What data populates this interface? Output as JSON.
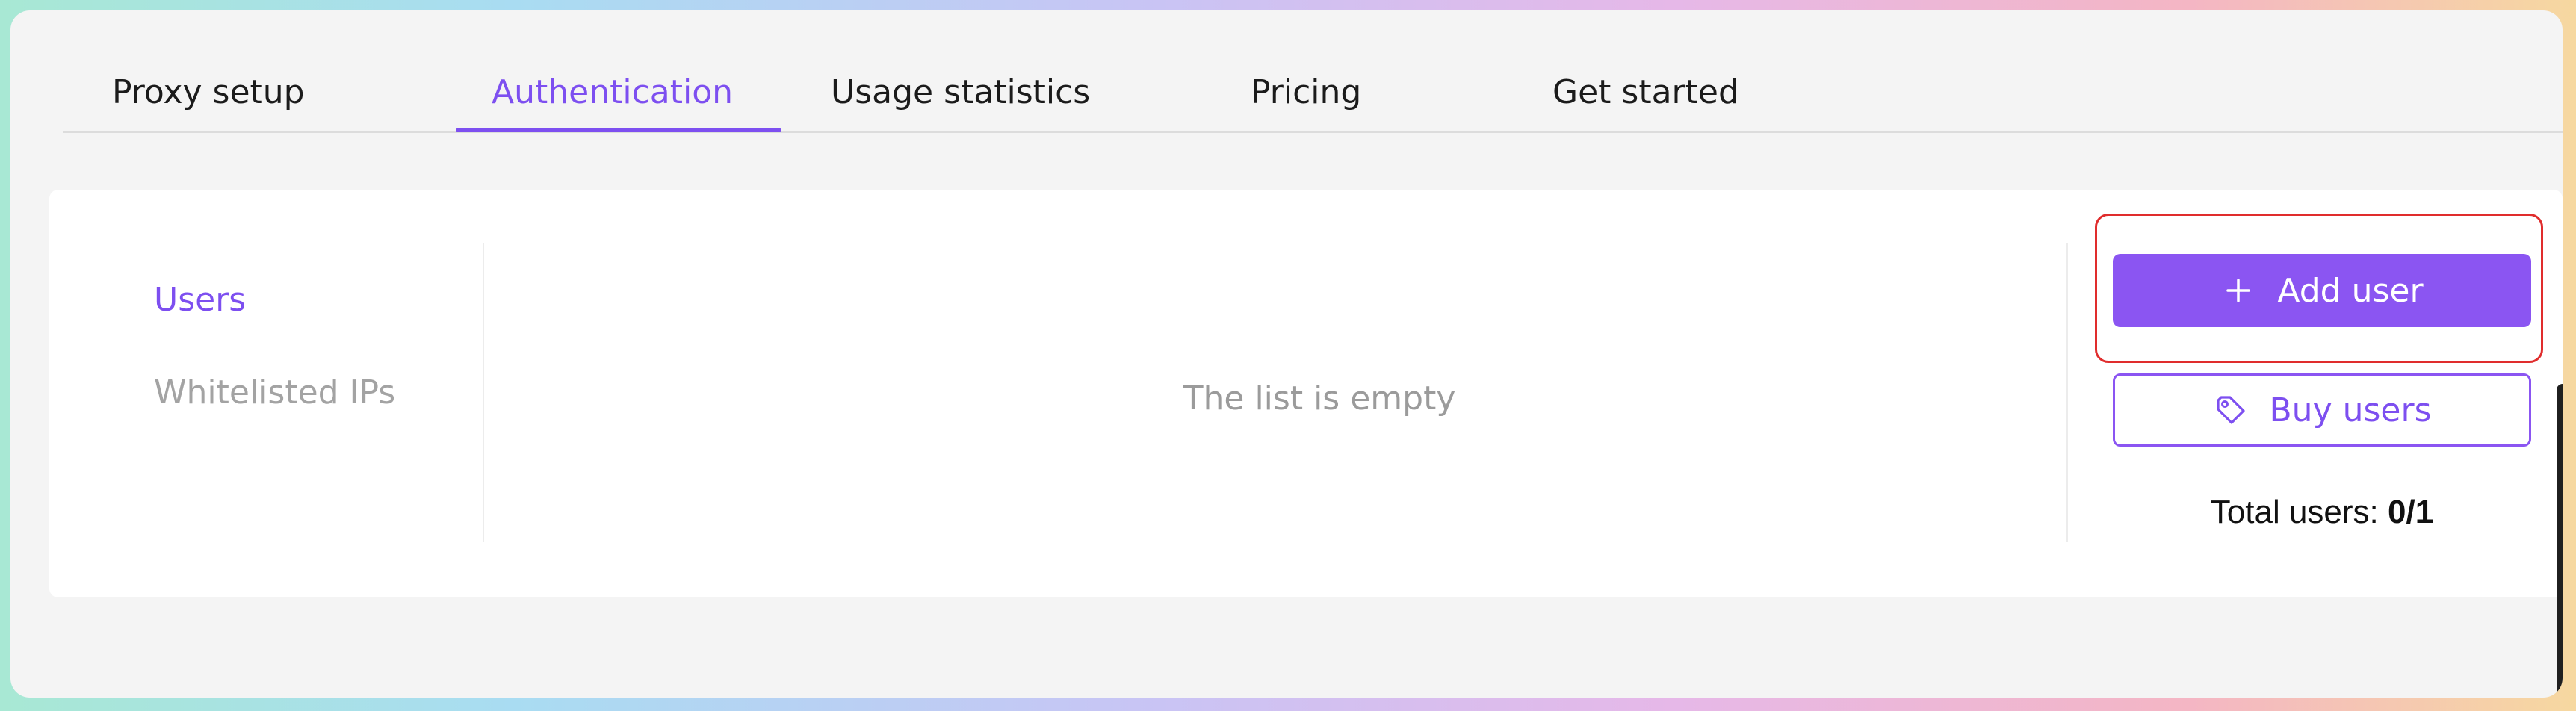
{
  "tabs": [
    {
      "label": "Proxy setup",
      "active": false
    },
    {
      "label": "Authentication",
      "active": true
    },
    {
      "label": "Usage statistics",
      "active": false
    },
    {
      "label": "Pricing",
      "active": false
    },
    {
      "label": "Get started",
      "active": false
    }
  ],
  "sidebar": {
    "items": [
      {
        "label": "Users",
        "active": true
      },
      {
        "label": "Whitelisted IPs",
        "active": false
      }
    ]
  },
  "main": {
    "empty_text": "The list is empty"
  },
  "actions": {
    "add_user_label": "Add user",
    "add_user_icon": "plus-icon",
    "buy_users_label": "Buy users",
    "buy_users_icon": "tag-icon",
    "total_users_label": "Total users:",
    "total_users_value": "0/1"
  },
  "colors": {
    "accent": "#8b55f2",
    "highlight": "#e02d2d"
  }
}
